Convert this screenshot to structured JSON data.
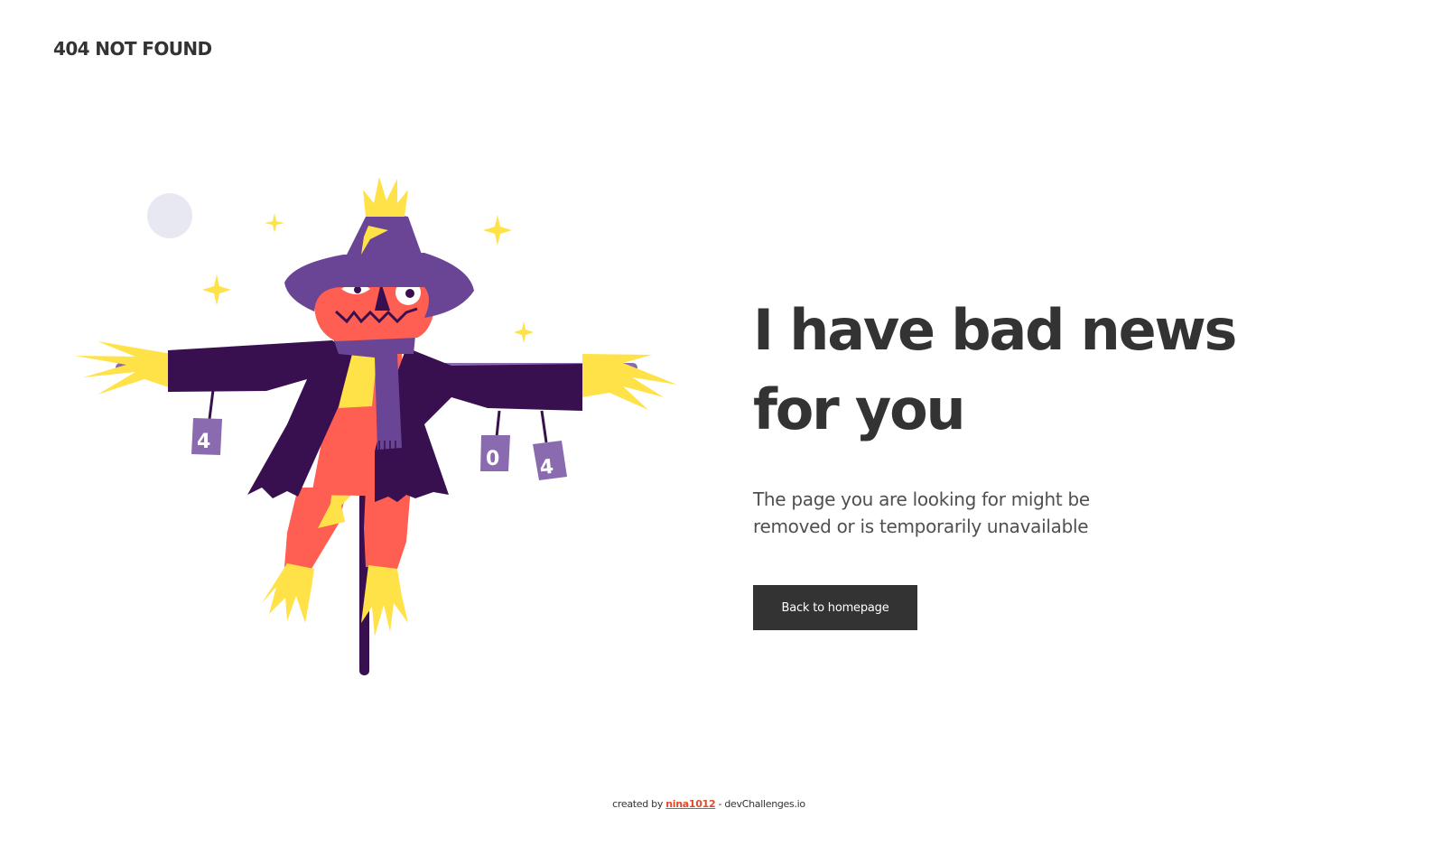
{
  "header": {
    "logo_text": "404 NOT FOUND"
  },
  "illustration": {
    "name": "scarecrow",
    "can_labels": [
      "4",
      "0",
      "4"
    ]
  },
  "main": {
    "headline": "I have bad news for you",
    "description": "The page you are looking for might be removed or is temporarily unavailable",
    "button_label": "Back to homepage"
  },
  "footer": {
    "prefix": "created by ",
    "author": "nina1012",
    "suffix": " - devChallenges.io"
  },
  "colors": {
    "text_dark": "#333333",
    "purple_dark": "#381050",
    "purple": "#6b4595",
    "purple_light": "#8a6bb0",
    "orange_red": "#ff5e52",
    "yellow": "#ffe148",
    "moon": "#e8e8f3",
    "link": "#e04b2a"
  }
}
